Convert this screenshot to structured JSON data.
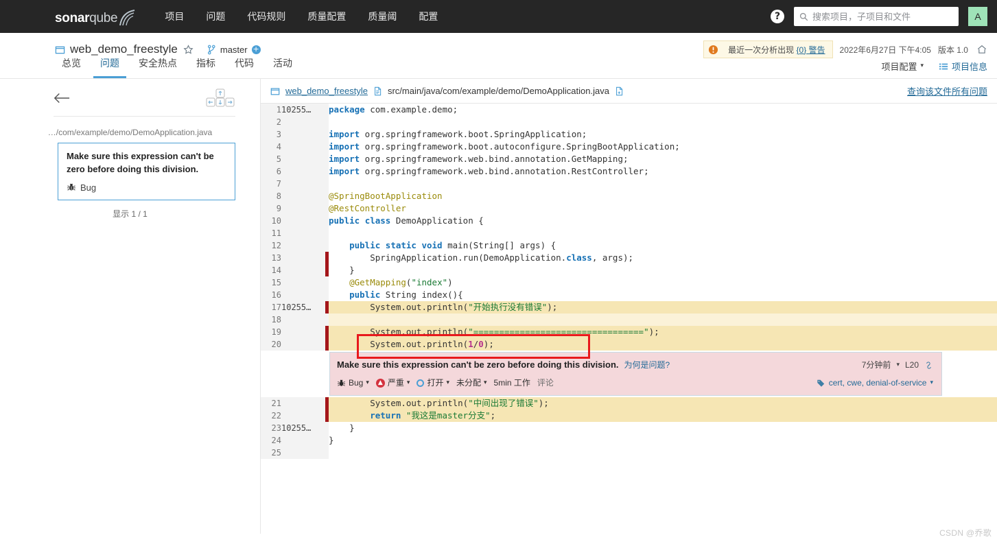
{
  "global_nav": {
    "logo": {
      "part1": "sonar",
      "part2": "qube",
      "icon": "sonarqube-swoosh-icon"
    },
    "items": [
      {
        "label": "项目",
        "name": "projects"
      },
      {
        "label": "问题",
        "name": "issues"
      },
      {
        "label": "代码规则",
        "name": "rules"
      },
      {
        "label": "质量配置",
        "name": "quality-profiles"
      },
      {
        "label": "质量阈",
        "name": "quality-gates"
      },
      {
        "label": "配置",
        "name": "administration"
      }
    ],
    "help_icon": "help-icon",
    "search": {
      "placeholder": "搜索项目，子项目和文件",
      "value": "",
      "icon": "search-icon"
    },
    "avatar": {
      "initial": "A",
      "color": "#9fe3b8"
    }
  },
  "project_bar": {
    "project_icon": "project-icon",
    "project_name": "web_demo_freestyle",
    "favorite_icon": "star-icon",
    "branch_icon": "branch-icon",
    "branch_name": "master",
    "branch_add_icon": "plus-circle-icon",
    "warning": {
      "icon": "warning-icon",
      "prefix": "最近一次分析出现",
      "link": "{0} 警告"
    },
    "analysis_date": "2022年6月27日 下午4:05",
    "version": "版本 1.0",
    "home_icon": "home-icon",
    "tabs": [
      {
        "label": "总览",
        "name": "overview",
        "active": false
      },
      {
        "label": "问题",
        "name": "issues",
        "active": true
      },
      {
        "label": "安全热点",
        "name": "security-hotspots",
        "active": false
      },
      {
        "label": "指标",
        "name": "measures",
        "active": false
      },
      {
        "label": "代码",
        "name": "code",
        "active": false
      },
      {
        "label": "活动",
        "name": "activity",
        "active": false
      }
    ],
    "project_settings": "项目配置",
    "project_information": "项目信息",
    "project_information_icon": "list-icon"
  },
  "sidebar": {
    "back_icon": "back-arrow-icon",
    "keyboard_hint_icon": "keyboard-arrows-icon",
    "file_path": "…/com/example/demo/DemoApplication.java",
    "issue_card": {
      "message": "Make sure this expression can't be zero before doing this division.",
      "type_icon": "bug-icon",
      "type_label": "Bug"
    },
    "count_label": "显示 1 / 1"
  },
  "file_header": {
    "project_icon": "project-icon",
    "project_name": "web_demo_freestyle",
    "file_icon": "file-icon",
    "file_path": "src/main/java/com/example/demo/DemoApplication.java",
    "copy_icon": "copy-file-icon",
    "all_issues_link": "查询该文件所有问题"
  },
  "code": {
    "lines": [
      {
        "n": "1",
        "scm": "10255…",
        "issue": false,
        "hl": "none",
        "html": "<span class='k'>package</span> com.example.demo;"
      },
      {
        "n": "2",
        "scm": "",
        "issue": false,
        "hl": "none",
        "html": ""
      },
      {
        "n": "3",
        "scm": "",
        "issue": false,
        "hl": "none",
        "html": "<span class='k'>import</span> org.springframework.boot.SpringApplication;"
      },
      {
        "n": "4",
        "scm": "",
        "issue": false,
        "hl": "none",
        "html": "<span class='k'>import</span> org.springframework.boot.autoconfigure.SpringBootApplication;"
      },
      {
        "n": "5",
        "scm": "",
        "issue": false,
        "hl": "none",
        "html": "<span class='k'>import</span> org.springframework.web.bind.annotation.GetMapping;"
      },
      {
        "n": "6",
        "scm": "",
        "issue": false,
        "hl": "none",
        "html": "<span class='k'>import</span> org.springframework.web.bind.annotation.RestController;"
      },
      {
        "n": "7",
        "scm": "",
        "issue": false,
        "hl": "none",
        "html": ""
      },
      {
        "n": "8",
        "scm": "",
        "issue": false,
        "hl": "none",
        "html": "<span class='ann'>@SpringBootApplication</span>"
      },
      {
        "n": "9",
        "scm": "",
        "issue": false,
        "hl": "none",
        "html": "<span class='ann'>@RestController</span>"
      },
      {
        "n": "10",
        "scm": "",
        "issue": false,
        "hl": "none",
        "html": "<span class='k'>public</span> <span class='k'>class</span> DemoApplication {"
      },
      {
        "n": "11",
        "scm": "",
        "issue": false,
        "hl": "none",
        "html": ""
      },
      {
        "n": "12",
        "scm": "",
        "issue": false,
        "hl": "none",
        "html": "    <span class='k'>public</span> <span class='k'>static</span> <span class='k'>void</span> main(String[] args) {"
      },
      {
        "n": "13",
        "scm": "",
        "issue": true,
        "hl": "none",
        "html": "        SpringApplication.run(DemoApplication.<span class='k'>class</span>, args);"
      },
      {
        "n": "14",
        "scm": "",
        "issue": true,
        "hl": "none",
        "html": "    }"
      },
      {
        "n": "15",
        "scm": "",
        "issue": false,
        "hl": "none",
        "html": "    <span class='ann'>@GetMapping</span>(<span class='str'>\"index\"</span>)"
      },
      {
        "n": "16",
        "scm": "",
        "issue": false,
        "hl": "none",
        "html": "    <span class='k'>public</span> String index(){"
      },
      {
        "n": "17",
        "scm": "10255…",
        "issue": true,
        "hl": "hl",
        "html": "        System.out.println(<span class='str'>\"开始执行没有错误\"</span>);"
      },
      {
        "n": "18",
        "scm": "",
        "issue": false,
        "hl": "hl-soft",
        "html": ""
      },
      {
        "n": "19",
        "scm": "",
        "issue": true,
        "hl": "hl",
        "html": "        System.out.println(<span class='str'>\"=================================\"</span>);"
      },
      {
        "n": "20",
        "scm": "",
        "issue": true,
        "hl": "hl",
        "html": "        System.out.println(<span class='num'>1</span>/<span class='num'>0</span>);"
      }
    ],
    "lines_after": [
      {
        "n": "21",
        "scm": "",
        "issue": true,
        "hl": "hl",
        "html": "        System.out.println(<span class='str'>\"中间出现了错误\"</span>);"
      },
      {
        "n": "22",
        "scm": "",
        "issue": true,
        "hl": "hl",
        "html": "        <span class='k'>return</span> <span class='str'>\"我这是master分支\"</span>;"
      },
      {
        "n": "23",
        "scm": "10255…",
        "issue": false,
        "hl": "none",
        "html": "    }"
      },
      {
        "n": "24",
        "scm": "",
        "issue": false,
        "hl": "none",
        "html": "}"
      },
      {
        "n": "25",
        "scm": "",
        "issue": false,
        "hl": "none",
        "html": ""
      }
    ]
  },
  "issue_box": {
    "message": "Make sure this expression can't be zero before doing this division.",
    "why_link": "为何是问题?",
    "age": "7分钟前",
    "line_ref": "L20",
    "permalink_icon": "link-icon",
    "type_icon": "bug-icon",
    "type_label": "Bug",
    "severity_icon": "severity-major-icon",
    "severity_label": "严重",
    "status_icon": "status-open-icon",
    "status_label": "打开",
    "assignee_label": "未分配",
    "effort_label": "5min 工作",
    "comment_label": "评论",
    "tags_icon": "tag-icon",
    "tags_label": "cert, cwe, denial-of-service"
  },
  "watermark": "CSDN @乔歌"
}
